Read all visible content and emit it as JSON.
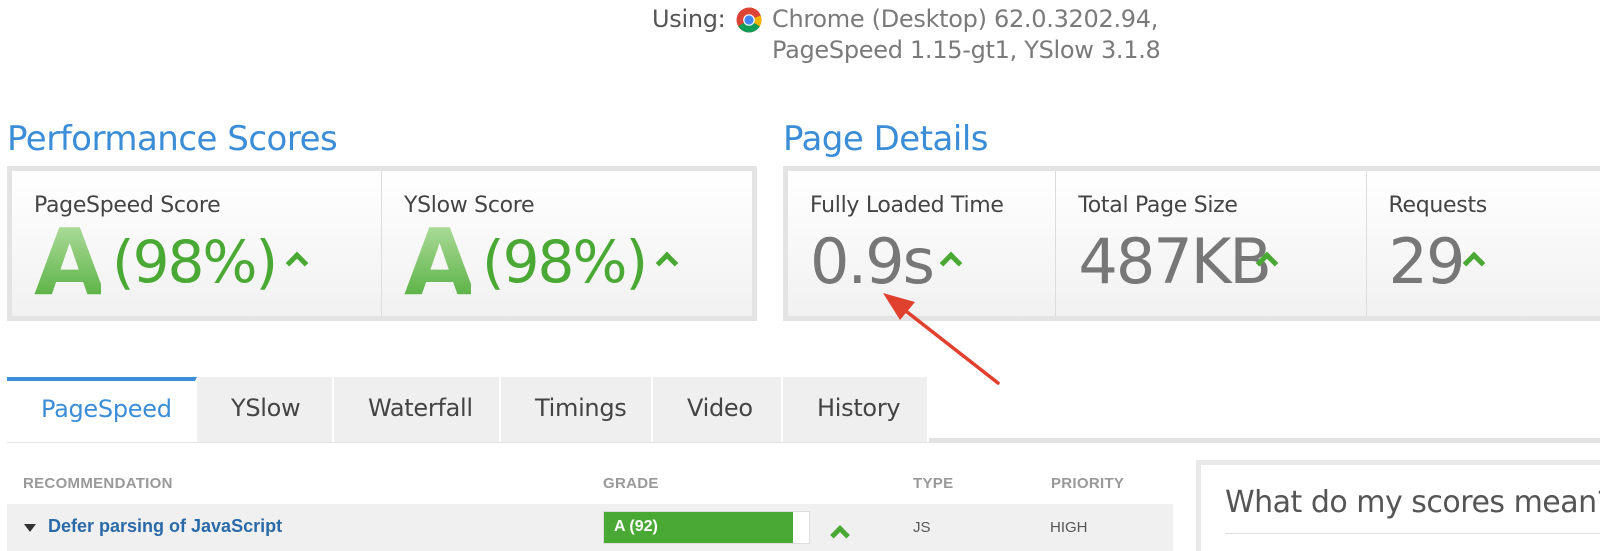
{
  "using": {
    "label": "Using:",
    "line1": "Chrome (Desktop) 62.0.3202.94,",
    "line2": "PageSpeed 1.15-gt1, YSlow 3.1.8"
  },
  "performance": {
    "title": "Performance Scores",
    "pagespeed": {
      "caption": "PageSpeed Score",
      "grade": "A",
      "percent": "(98%)"
    },
    "yslow": {
      "caption": "YSlow Score",
      "grade": "A",
      "percent": "(98%)"
    }
  },
  "details": {
    "title": "Page Details",
    "loaded": {
      "caption": "Fully Loaded Time",
      "value": "0.9s"
    },
    "size": {
      "caption": "Total Page Size",
      "value": "487KB"
    },
    "requests": {
      "caption": "Requests",
      "value": "29"
    }
  },
  "tabs": [
    {
      "label": "PageSpeed",
      "active": true
    },
    {
      "label": "YSlow"
    },
    {
      "label": "Waterfall"
    },
    {
      "label": "Timings"
    },
    {
      "label": "Video"
    },
    {
      "label": "History"
    }
  ],
  "table": {
    "headers": {
      "recommendation": "RECOMMENDATION",
      "grade": "GRADE",
      "type": "TYPE",
      "priority": "PRIORITY"
    },
    "rows": [
      {
        "recommendation": "Defer parsing of JavaScript",
        "grade_label": "A (92)",
        "grade_value": 92,
        "type": "JS",
        "priority": "HIGH"
      }
    ]
  },
  "sidebar": {
    "title": "What do my scores mean?"
  },
  "colors": {
    "accent": "#3a8dd6",
    "good": "#4aa934",
    "annotation": "#e0402e"
  },
  "icons": {
    "browser": "chrome-icon",
    "trend": "chevron-up-icon"
  }
}
